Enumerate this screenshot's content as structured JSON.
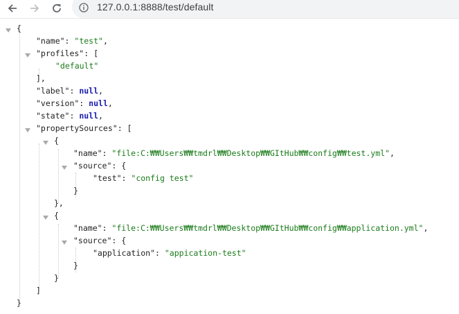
{
  "browser": {
    "url": "127.0.0.1:8888/test/default",
    "icons": {
      "back": "back-arrow-icon",
      "forward": "forward-arrow-icon",
      "reload": "reload-icon",
      "site_info": "info-icon"
    }
  },
  "json": {
    "open_brace": "{",
    "close_brace": "}",
    "name_key": "\"name\"",
    "name_value": "\"test\"",
    "profiles_key": "\"profiles\"",
    "profiles_item": "\"default\"",
    "label_key": "\"label\"",
    "version_key": "\"version\"",
    "state_key": "\"state\"",
    "null_value": "null",
    "propertySources_key": "\"propertySources\"",
    "source_key": "\"source\"",
    "sources": [
      {
        "name_value": "\"file:C:₩₩Users₩₩tmdrl₩₩Desktop₩₩GItHub₩₩config₩₩test.yml\"",
        "inner_key": "\"test\"",
        "inner_value": "\"config test\""
      },
      {
        "name_value": "\"file:C:₩₩Users₩₩tmdrl₩₩Desktop₩₩GItHub₩₩config₩₩application.yml\"",
        "inner_key": "\"application\"",
        "inner_value": "\"appication-test\""
      }
    ]
  },
  "colors": {
    "string": "#1a7b1a",
    "keyword": "#1a1ab0",
    "key": "#1f1f1f"
  }
}
